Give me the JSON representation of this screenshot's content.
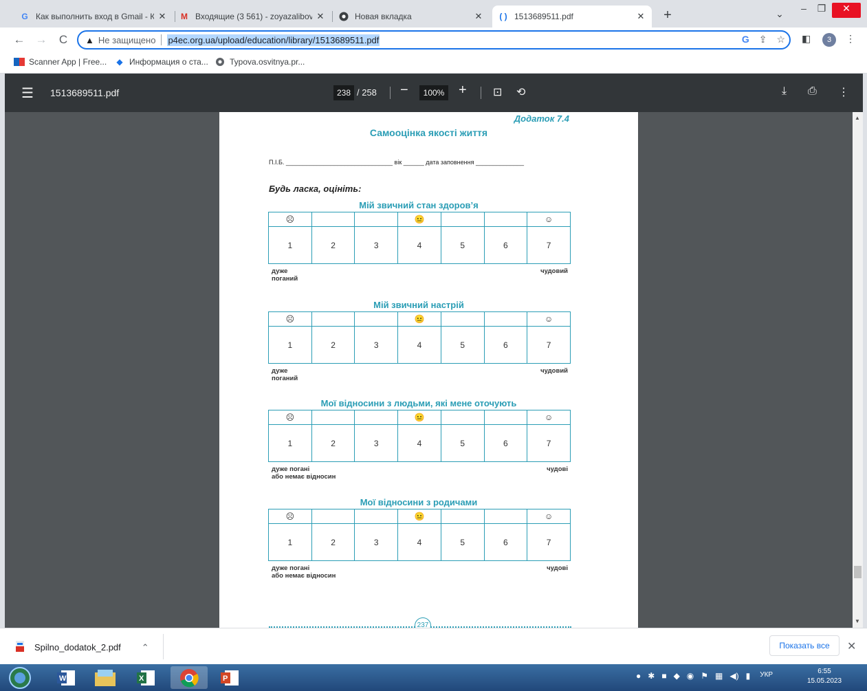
{
  "tabs": [
    {
      "title": "Как выполнить вход в Gmail - Ко",
      "icon": "google-g-icon"
    },
    {
      "title": "Входящие (3 561) - zoyazalibovsk",
      "icon": "gmail-icon"
    },
    {
      "title": "Новая вкладка",
      "icon": "chrome-icon"
    },
    {
      "title": "1513689511.pdf",
      "icon": "pdf-tab-icon"
    }
  ],
  "address_bar": {
    "security": "Не защищено",
    "url": "p4ec.org.ua/upload/education/library/1513689511.pdf"
  },
  "profile": {
    "count": "3"
  },
  "bookmarks": [
    "Scanner App | Free...",
    "Информация о ста...",
    "Typova.osvitnya.pr..."
  ],
  "pdf_toolbar": {
    "filename": "1513689511.pdf",
    "page": "238",
    "total": "/ 258",
    "zoom": "100%"
  },
  "page": {
    "appendix": "Додаток 7.4",
    "title": "Самооцінка якості життя",
    "form_line": "П.І.Б. _______________________________ вік ______ дата заповнення ______________",
    "instruction": "Будь ласка, оцініть:",
    "faces": [
      "☹",
      "",
      "",
      "😐",
      "",
      "",
      "☺"
    ],
    "numbers": [
      "1",
      "2",
      "3",
      "4",
      "5",
      "6",
      "7"
    ],
    "sections": [
      {
        "title": "Мій звичний стан здоров’я",
        "low": "дуже\nпоганий",
        "high": "чудовий"
      },
      {
        "title": "Мій звичний настрій",
        "low": "дуже\nпоганий",
        "high": "чудовий"
      },
      {
        "title": "Мої відносини з людьми, які мене оточують",
        "low": "дуже погані\nабо немає відносин",
        "high": "чудові"
      },
      {
        "title": "Мої відносини з родичами",
        "low": "дуже погані\nабо немає відносин",
        "high": "чудові"
      }
    ],
    "page_number": "237"
  },
  "downloads": {
    "file": "Spilno_dodatok_2.pdf",
    "show_all": "Показать все"
  },
  "taskbar": {
    "lang": "УКР",
    "time": "6:55",
    "date": "15.05.2023"
  }
}
